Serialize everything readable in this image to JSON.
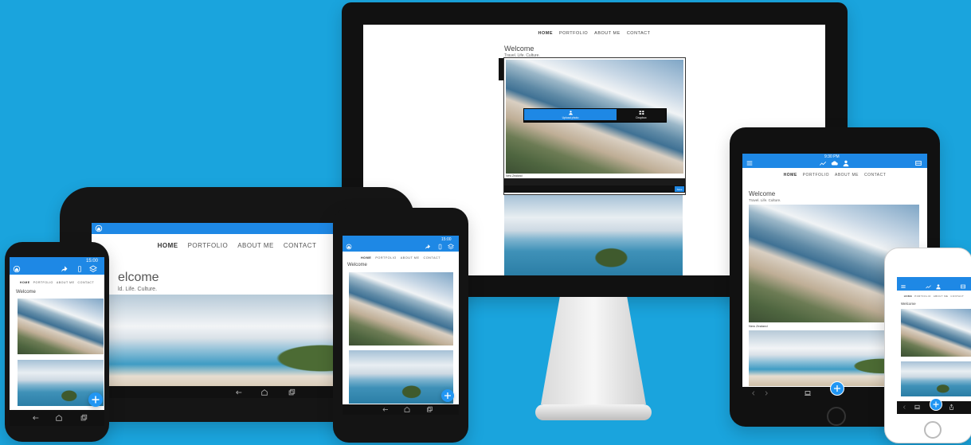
{
  "colors": {
    "background": "#1aa4dd",
    "brand_blue": "#1e88e5",
    "fab_blue": "#2196f3",
    "device_black": "#121212"
  },
  "nav": {
    "items": [
      "HOME",
      "PORTFOLIO",
      "ABOUT ME",
      "CONTACT"
    ]
  },
  "page": {
    "title": "Welcome",
    "subtitle_desktop": "Travel. Life. Culture.",
    "subtitle_tablet_android_partial": "ld. Life. Culture.",
    "title_tablet_android_partial": "elcome"
  },
  "status": {
    "time_android_phone": "15:00",
    "time_ios_tablet": "9:30 PM",
    "time_android_small_tablet": "15:00"
  },
  "editor": {
    "upload_label": "Upload photo",
    "dropbox_label": "Dropbox",
    "caption_label": "New Zealand",
    "save_label": "Save",
    "caption_ipad": "New Zealand"
  },
  "icons": [
    "home-icon",
    "share-icon",
    "phone-icon",
    "layers-icon",
    "menu-icon",
    "chart-icon",
    "user-icon",
    "cloud-icon",
    "back-icon",
    "home-nav-icon",
    "recents-icon",
    "plus-icon",
    "laptop-icon",
    "share-square-icon",
    "chevron-left-icon",
    "chevron-right-icon"
  ]
}
